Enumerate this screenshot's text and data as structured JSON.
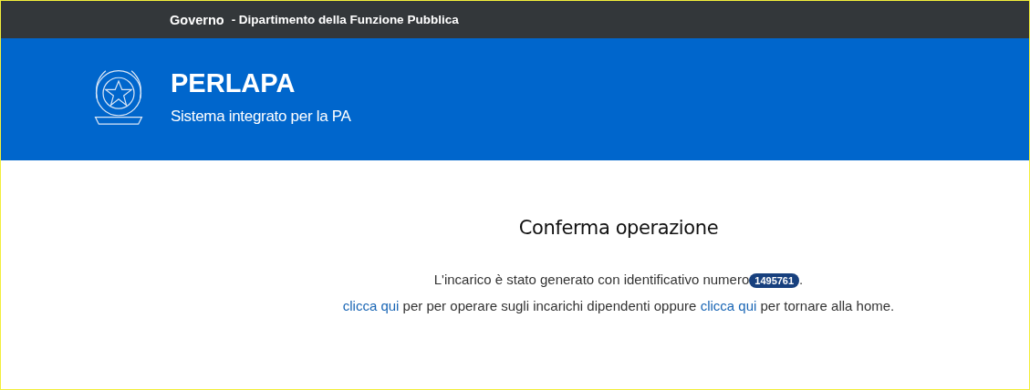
{
  "top_bar": {
    "organization": "Governo",
    "department": "- Dipartimento della Funzione Pubblica"
  },
  "header": {
    "title": "PERLAPA",
    "subtitle": "Sistema integrato per la PA"
  },
  "main": {
    "title": "Conferma operazione",
    "message": {
      "text": "L'incarico è stato generato con identificativo numero",
      "badge": "1495761",
      "end": "."
    },
    "links_line": [
      {
        "kind": "link",
        "text": "clicca qui"
      },
      {
        "kind": "text",
        "text": " per per operare sugli incarichi dipendenti oppure "
      },
      {
        "kind": "link",
        "text": "clicca qui"
      },
      {
        "kind": "text",
        "text": " per tornare alla home."
      }
    ]
  }
}
